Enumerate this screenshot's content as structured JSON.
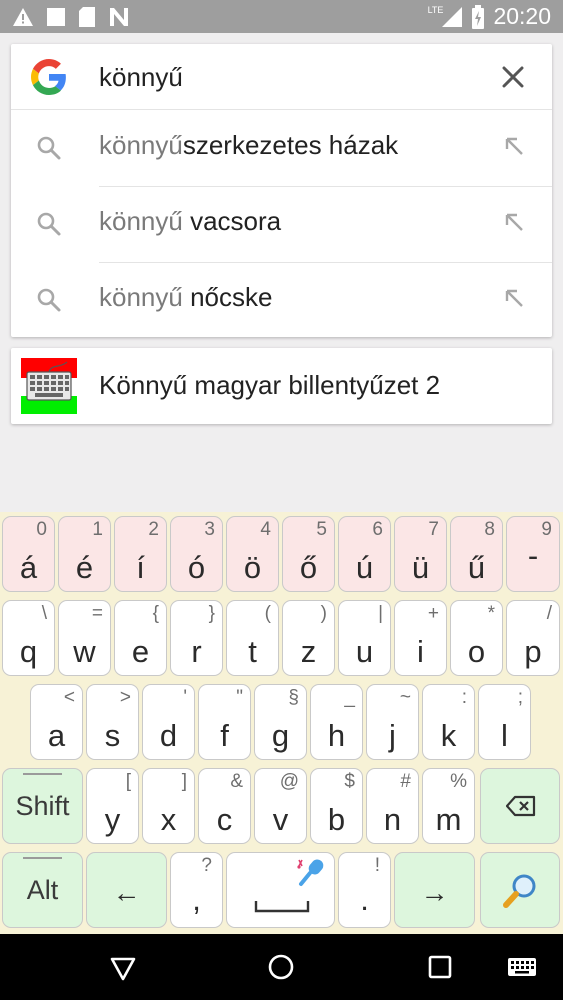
{
  "status_bar": {
    "time": "20:20",
    "network_label": "LTE",
    "icons": [
      "warning-icon",
      "notification-square-icon",
      "sd-card-icon",
      "n-app-icon",
      "signal-icon",
      "battery-icon"
    ]
  },
  "search": {
    "query": "könnyű",
    "placeholder": "",
    "suggestions": [
      {
        "query_part": "könnyű",
        "completion": "szerkezetes házak"
      },
      {
        "query_part": "könnyű",
        "completion": " vacsora"
      },
      {
        "query_part": "könnyű",
        "completion": " nőcske"
      }
    ]
  },
  "app_result": {
    "title": "Könnyű magyar billentyűzet 2",
    "icon": "keyboard-app-icon"
  },
  "keyboard": {
    "row1": [
      {
        "main": "á",
        "sub": "0"
      },
      {
        "main": "é",
        "sub": "1"
      },
      {
        "main": "í",
        "sub": "2"
      },
      {
        "main": "ó",
        "sub": "3"
      },
      {
        "main": "ö",
        "sub": "4"
      },
      {
        "main": "ő",
        "sub": "5"
      },
      {
        "main": "ú",
        "sub": "6"
      },
      {
        "main": "ü",
        "sub": "7"
      },
      {
        "main": "ű",
        "sub": "8"
      },
      {
        "main": "-",
        "sub": "9"
      }
    ],
    "row2": [
      {
        "main": "q",
        "sub": "\\"
      },
      {
        "main": "w",
        "sub": "="
      },
      {
        "main": "e",
        "sub": "{"
      },
      {
        "main": "r",
        "sub": "}"
      },
      {
        "main": "t",
        "sub": "("
      },
      {
        "main": "z",
        "sub": ")"
      },
      {
        "main": "u",
        "sub": "|"
      },
      {
        "main": "i",
        "sub": "+"
      },
      {
        "main": "o",
        "sub": "*"
      },
      {
        "main": "p",
        "sub": "/"
      }
    ],
    "row3": [
      {
        "main": "a",
        "sub": "<"
      },
      {
        "main": "s",
        "sub": ">"
      },
      {
        "main": "d",
        "sub": "'"
      },
      {
        "main": "f",
        "sub": "\""
      },
      {
        "main": "g",
        "sub": "§"
      },
      {
        "main": "h",
        "sub": "_"
      },
      {
        "main": "j",
        "sub": "~"
      },
      {
        "main": "k",
        "sub": ":"
      },
      {
        "main": "l",
        "sub": ";"
      }
    ],
    "row4": [
      {
        "main": "y",
        "sub": "["
      },
      {
        "main": "x",
        "sub": "]"
      },
      {
        "main": "c",
        "sub": "&"
      },
      {
        "main": "v",
        "sub": "@"
      },
      {
        "main": "b",
        "sub": "$"
      },
      {
        "main": "n",
        "sub": "#"
      },
      {
        "main": "m",
        "sub": "%"
      }
    ],
    "shift_label": "Shift",
    "alt_label": "Alt",
    "left_arrow": "←",
    "right_arrow": "→",
    "comma": {
      "main": ",",
      "sub": "?"
    },
    "period": {
      "main": ".",
      "sub": "!"
    },
    "colors": {
      "background": "#f7f2d6",
      "pink_key": "#fbe6e6",
      "green_key": "#ddf6dd"
    }
  },
  "nav_bar": {
    "icons": [
      "back-icon",
      "home-icon",
      "recents-icon",
      "keyboard-switch-icon"
    ]
  }
}
